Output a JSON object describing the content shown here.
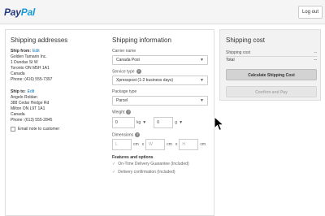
{
  "header": {
    "logo_pay": "Pay",
    "logo_pal": "Pal",
    "logout_label": "Log out"
  },
  "addresses": {
    "title": "Shipping addresses",
    "ship_from_label": "Ship from:",
    "ship_from_edit": "Edit",
    "ship_from_lines": [
      "Golden Tamarin Inc.",
      "1 Dundas St W",
      "Toronto ON M5H 1A1",
      "Canada",
      "Phone: (416) 555-7397"
    ],
    "ship_to_label": "Ship to:",
    "ship_to_edit": "Edit",
    "ship_to_lines": [
      "Angelo Roldan",
      "388 Cedar Hedge Rd",
      "Milton ON L9T 1A1",
      "Canada",
      "Phone: (613) 555-2845"
    ],
    "email_notice": "Email note to customer"
  },
  "shipping": {
    "title": "Shipping information",
    "carrier_label": "Carrier name",
    "carrier_value": "Canada Post",
    "service_label": "Service type",
    "service_value": "Xpresspost (1-2 business days)",
    "package_label": "Package type",
    "package_value": "Parcel",
    "weight_label": "Weight",
    "weight_kg_value": "0",
    "weight_kg_unit": "kg",
    "weight_g_value": "0",
    "weight_g_unit": "g",
    "dimensions_label": "Dimensions",
    "dim_l_placeholder": "L",
    "dim_w_placeholder": "W",
    "dim_h_placeholder": "H",
    "dim_unit": "cm",
    "dim_x": "x",
    "features_label": "Features and options",
    "feature_1": "On-Time Delivery Guarantee (Included)",
    "feature_2": "Delivery confirmation (Included)"
  },
  "cost": {
    "title": "Shipping cost",
    "shipping_cost_label": "Shipping cost",
    "shipping_cost_value": "--",
    "total_label": "Total",
    "total_value": "--",
    "calc_button": "Calculate Shipping Cost",
    "confirm_button": "Confirm and Pay"
  }
}
